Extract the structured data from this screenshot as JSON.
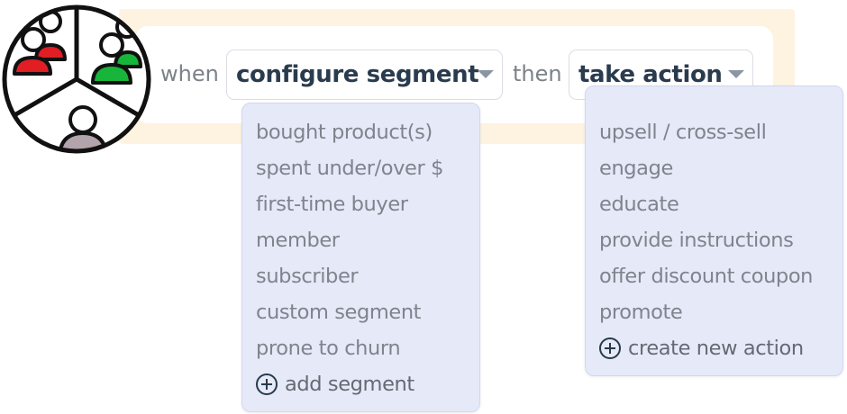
{
  "rule": {
    "when_label": "when",
    "then_label": "then",
    "segment_select": {
      "value": "configure segment",
      "options": [
        "bought product(s)",
        "spent under/over $",
        "first-time buyer",
        "member",
        "subscriber",
        "custom segment",
        "prone to churn"
      ],
      "add_label": "add segment"
    },
    "action_select": {
      "value": "take action",
      "options": [
        "upsell / cross-sell",
        "engage",
        "educate",
        "provide instructions",
        "offer discount coupon",
        "promote"
      ],
      "add_label": "create new action"
    }
  },
  "logo": {
    "icon": "customer-segments-icon",
    "colors": {
      "red": "#e01e24",
      "green": "#18b53b",
      "gray": "#b3a3aa",
      "outline": "#111111"
    }
  },
  "colors": {
    "label_text": "#2a3b4e",
    "menu_background": "#e6e9f8",
    "backdrop": "#fdf3e0"
  }
}
